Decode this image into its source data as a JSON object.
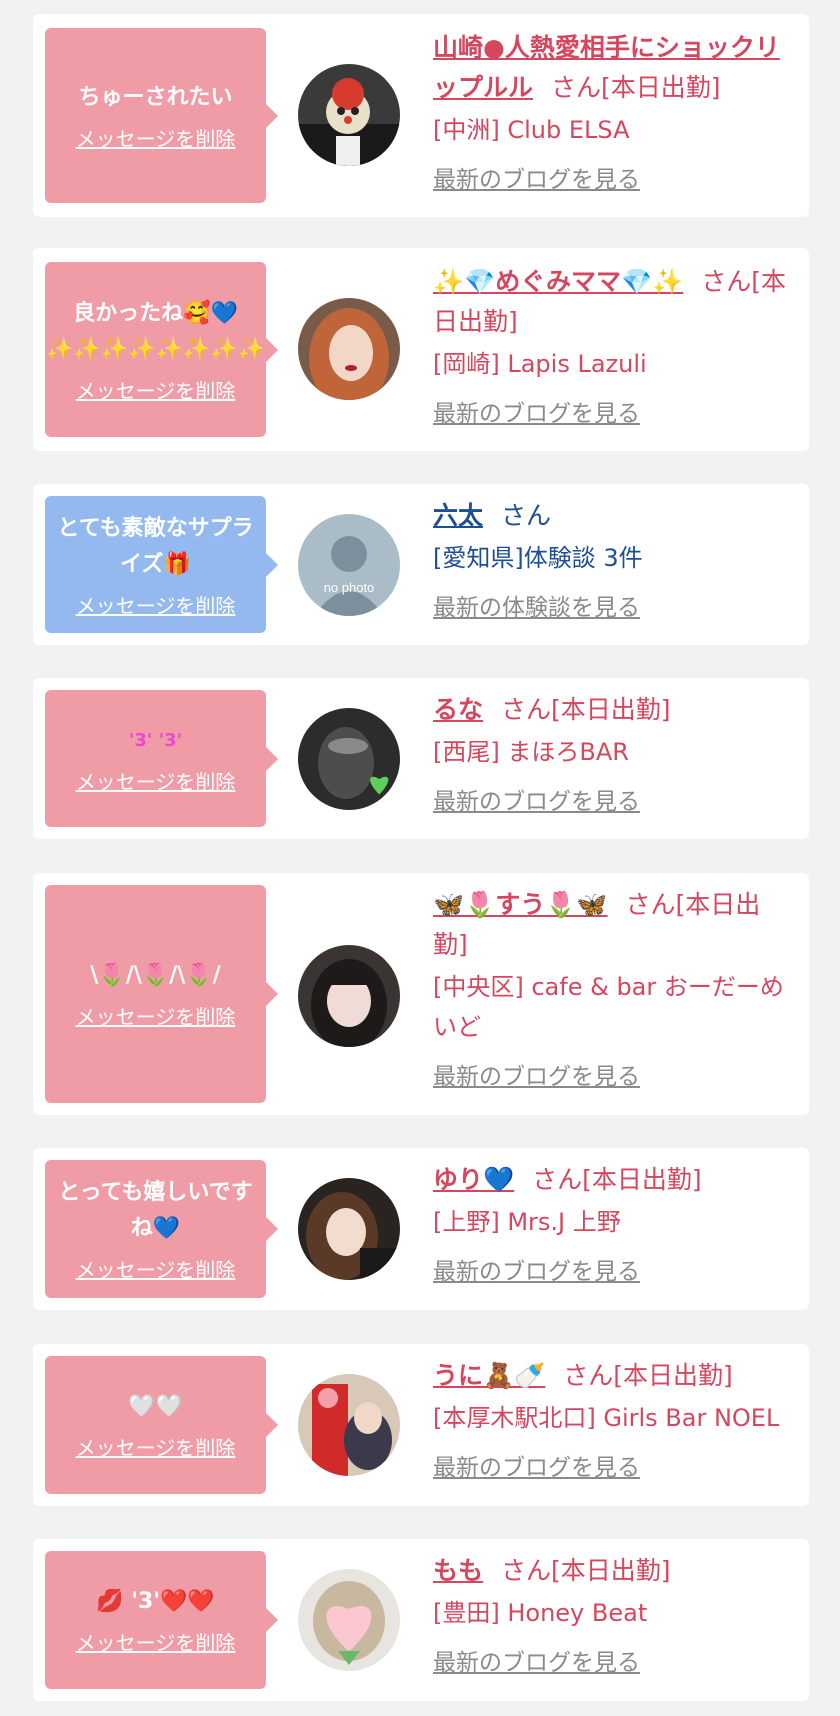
{
  "delete_label": "メッセージを削除",
  "san_label": "さん",
  "entries": [
    {
      "message": "ちゅーされたい",
      "name": "山崎●人熱愛相手にショックリップルル",
      "status": "[本日出勤]",
      "shop": "[中洲] Club ELSA",
      "link": "最新のブログを見る",
      "bubble_color": "pink"
    },
    {
      "message": "良かったね🥰💙✨✨✨✨✨✨✨✨",
      "name": "✨💎めぐみママ💎✨",
      "status": "[本日出勤]",
      "shop": "[岡崎] Lapis Lazuli",
      "link": "最新のブログを見る",
      "bubble_color": "pink"
    },
    {
      "message": "とても素敵なサプライズ🎁",
      "name": "六太",
      "status": "",
      "shop": "[愛知県]体験談 3件",
      "link": "最新の体験談を見る",
      "bubble_color": "blue"
    },
    {
      "message": "'3' '3'",
      "name": "るな",
      "status": "[本日出勤]",
      "shop": "[西尾] まほろBAR",
      "link": "最新のブログを見る",
      "bubble_color": "pink"
    },
    {
      "message": "\\🌷/\\🌷/\\🌷/",
      "name": "🦋🌷すう🌷🦋",
      "status": "[本日出勤]",
      "shop": "[中央区] cafe & bar おーだーめいど",
      "link": "最新のブログを見る",
      "bubble_color": "pink"
    },
    {
      "message": "とっても嬉しいですね💙",
      "name": "ゆり💙",
      "status": "[本日出勤]",
      "shop": "[上野] Mrs.J 上野",
      "link": "最新のブログを見る",
      "bubble_color": "pink"
    },
    {
      "message": "🤍🤍",
      "name": "うに🧸🍼",
      "status": "[本日出勤]",
      "shop": "[本厚木駅北口] Girls Bar NOEL",
      "link": "最新のブログを見る",
      "bubble_color": "pink"
    },
    {
      "message": "💋 '3'❤️❤️",
      "name": "もも",
      "status": "[本日出勤]",
      "shop": "[豊田] Honey Beat",
      "link": "最新のブログを見る",
      "bubble_color": "pink"
    }
  ]
}
